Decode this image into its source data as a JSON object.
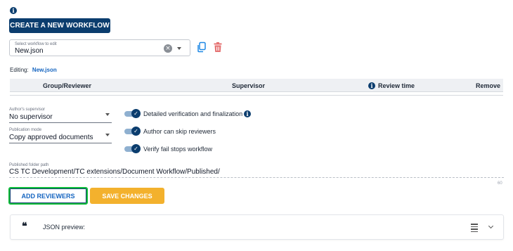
{
  "header": {
    "info_icon": "info-icon",
    "create_button": "CREATE A NEW WORKFLOW"
  },
  "workflow_select": {
    "caption": "Select workflow to edit",
    "value": "New.json",
    "clear_icon": "clear-icon",
    "dropdown_icon": "chevron-down-icon",
    "copy_icon": "copy-icon",
    "delete_icon": "trash-icon"
  },
  "editing": {
    "label": "Editing:",
    "file": "New.json"
  },
  "table": {
    "columns": [
      "Group/Reviewer",
      "Supervisor",
      "Review time",
      "Remove"
    ],
    "rows": []
  },
  "options": {
    "author_supervisor": {
      "caption": "Author's supervisor",
      "value": "No supervisor"
    },
    "publication_mode": {
      "caption": "Publication mode",
      "value": "Copy approved documents"
    }
  },
  "toggles": [
    {
      "label": "Detailed verification and finalization",
      "checked": true,
      "has_info": true
    },
    {
      "label": "Author can skip reviewers",
      "checked": true,
      "has_info": false
    },
    {
      "label": "Verify fail stops workflow",
      "checked": true,
      "has_info": false
    }
  ],
  "published_path": {
    "caption": "Published folder path",
    "value": "CS TC Development/TC extensions/Document Workflow/Published/",
    "counter": "60"
  },
  "actions": {
    "add_reviewers": "ADD REVIEWERS",
    "save_changes": "SAVE CHANGES"
  },
  "json_preview": {
    "quote_icon": "quote-icon",
    "label": "JSON preview:",
    "menu_icon": "menu-icon",
    "expand_icon": "chevron-down-icon"
  },
  "colors": {
    "primary": "#0b3d6e",
    "accent_yellow": "#f3b12d",
    "focus_green": "#0fbf3a",
    "delete_red": "#e57373",
    "copy_blue": "#1e88e5"
  }
}
